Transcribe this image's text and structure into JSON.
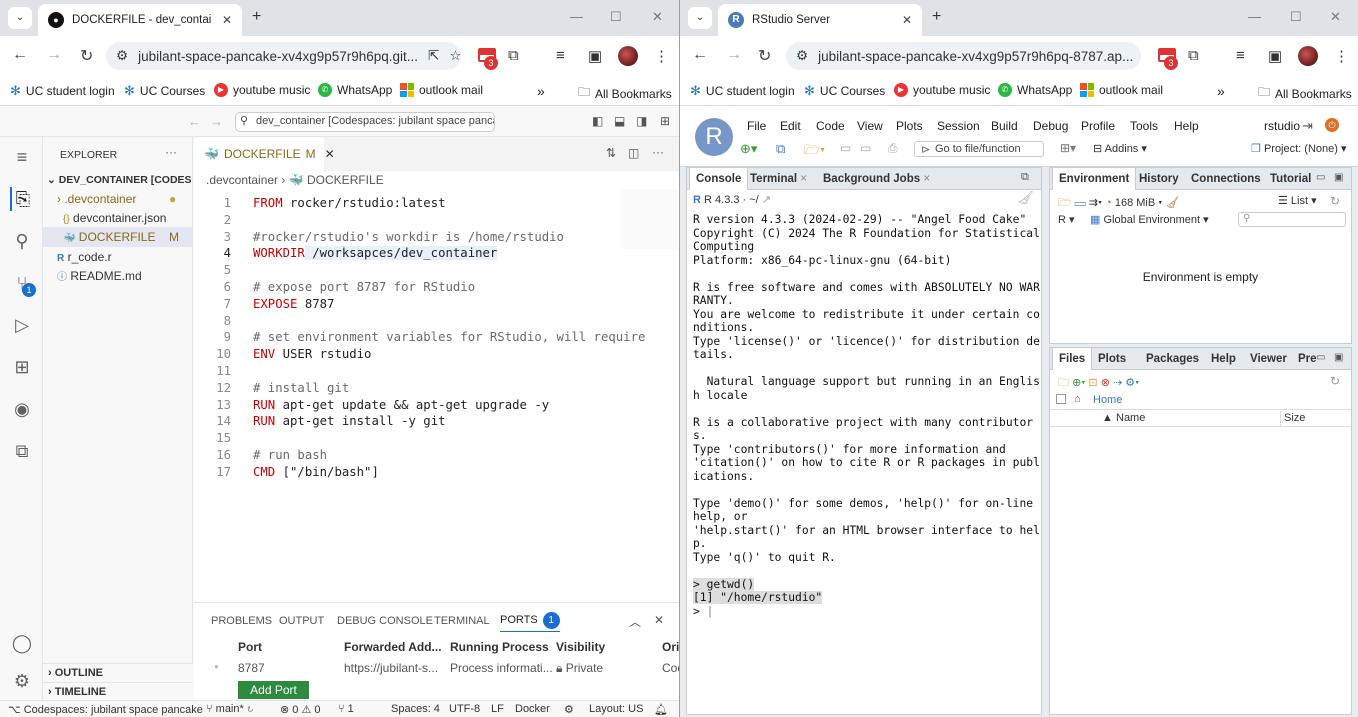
{
  "left_window": {
    "tab_title": "DOCKERFILE - dev_container [C",
    "url": "jubilant-space-pancake-xv4xg9p57r9h6pq.git...",
    "gmail_count": "3"
  },
  "right_window": {
    "tab_title": "RStudio Server",
    "url": "jubilant-space-pancake-xv4xg9p57r9h6pq-8787.ap...",
    "gmail_count": "3"
  },
  "bookmarks": {
    "items": [
      "UC student login",
      "UC Courses",
      "youtube music",
      "WhatsApp",
      "outlook mail"
    ],
    "more": "»",
    "all": "All Bookmarks"
  },
  "vscode": {
    "search": "dev_container [Codespaces: jubilant space pancake",
    "explorer_title": "EXPLORER",
    "root": "DEV_CONTAINER [CODESP...",
    "files": [
      {
        "name": ".devcontainer",
        "icon": "›"
      },
      {
        "name": "devcontainer.json",
        "icon": "{}"
      },
      {
        "name": "DOCKERFILE",
        "icon": "🐳",
        "badge": "M"
      },
      {
        "name": "r_code.r",
        "icon": "R"
      },
      {
        "name": "README.md",
        "icon": "ⓘ"
      }
    ],
    "source_control_badge": "1",
    "tab_label": "DOCKERFILE",
    "tab_badge": "M",
    "breadcrumb_folder": ".devcontainer",
    "breadcrumb_file": "DOCKERFILE",
    "code": [
      {
        "n": "1",
        "kw": "FROM",
        "rest": " rocker/rstudio:latest"
      },
      {
        "n": "2",
        "kw": "",
        "rest": ""
      },
      {
        "n": "3",
        "kw": "",
        "rest": "#rocker/rstudio's workdir is /home/rstudio",
        "comment": true
      },
      {
        "n": "4",
        "kw": "WORKDIR",
        "rest": " /worksapces/dev_container",
        "current": true
      },
      {
        "n": "5",
        "kw": "",
        "rest": ""
      },
      {
        "n": "6",
        "kw": "",
        "rest": "# expose port 8787 for RStudio",
        "comment": true
      },
      {
        "n": "7",
        "kw": "EXPOSE",
        "rest": " 8787"
      },
      {
        "n": "8",
        "kw": "",
        "rest": ""
      },
      {
        "n": "9",
        "kw": "",
        "rest": "# set environment variables for RStudio, will require",
        "comment": true
      },
      {
        "n": "10",
        "kw": "ENV",
        "rest": " USER rstudio"
      },
      {
        "n": "11",
        "kw": "",
        "rest": ""
      },
      {
        "n": "12",
        "kw": "",
        "rest": "# install git",
        "comment": true
      },
      {
        "n": "13",
        "kw": "RUN",
        "rest": " apt-get update && apt-get upgrade -y"
      },
      {
        "n": "14",
        "kw": "RUN",
        "rest": " apt-get install -y git"
      },
      {
        "n": "15",
        "kw": "",
        "rest": ""
      },
      {
        "n": "16",
        "kw": "",
        "rest": "# run bash",
        "comment": true
      },
      {
        "n": "17",
        "kw": "CMD",
        "rest": " [\"/bin/bash\"]"
      }
    ],
    "panel_tabs": [
      "PROBLEMS",
      "OUTPUT",
      "DEBUG CONSOLE",
      "TERMINAL",
      "PORTS"
    ],
    "ports_count": "1",
    "ports_headers": [
      "Port",
      "Forwarded Add...",
      "Running Process",
      "Visibility",
      "Ori"
    ],
    "ports_row": [
      "8787",
      "https://jubilant-s...",
      "Process informati...",
      "Private",
      "Coc"
    ],
    "add_port": "Add Port",
    "outline": "OUTLINE",
    "timeline": "TIMELINE",
    "status": {
      "remote": "Codespaces: jubilant space pancake",
      "branch": "main*",
      "errors": "0",
      "warnings": "0",
      "ports": "1",
      "spaces": "Spaces: 4",
      "encoding": "UTF-8",
      "eol": "LF",
      "language": "Docker",
      "layout": "Layout: US"
    }
  },
  "rstudio": {
    "menu": [
      "File",
      "Edit",
      "Code",
      "View",
      "Plots",
      "Session",
      "Build",
      "Debug",
      "Profile",
      "Tools",
      "Help"
    ],
    "user": "rstudio",
    "goto": "Go to file/function",
    "addins": "Addins",
    "project": "Project: (None)",
    "console_tabs": [
      "Console",
      "Terminal",
      "Background Jobs"
    ],
    "r_version": "R 4.3.3 · ~/",
    "console_lines": [
      "R version 4.3.3 (2024-02-29) -- \"Angel Food Cake\"",
      "Copyright (C) 2024 The R Foundation for Statistical",
      "Computing",
      "Platform: x86_64-pc-linux-gnu (64-bit)",
      "",
      "R is free software and comes with ABSOLUTELY NO WAR",
      "RANTY.",
      "You are welcome to redistribute it under certain co",
      "nditions.",
      "Type 'license()' or 'licence()' for distribution de",
      "tails.",
      "",
      "  Natural language support but running in an Englis",
      "h locale",
      "",
      "R is a collaborative project with many contributor",
      "s.",
      "Type 'contributors()' for more information and",
      "'citation()' on how to cite R or R packages in publ",
      "ications.",
      "",
      "Type 'demo()' for some demos, 'help()' for on-line",
      "help, or",
      "'help.start()' for an HTML browser interface to hel",
      "p.",
      "Type 'q()' to quit R.",
      ""
    ],
    "cmd": "> getwd()",
    "result": "[1] \"/home/rstudio\"",
    "prompt": ">",
    "env_tabs": [
      "Environment",
      "History",
      "Connections",
      "Tutorial"
    ],
    "memory": "168 MiB",
    "list": "List",
    "r_select": "R",
    "global_env": "Global Environment",
    "env_empty": "Environment is empty",
    "files_tabs": [
      "Files",
      "Plots",
      "Packages",
      "Help",
      "Viewer",
      "Pre"
    ],
    "home": "Home",
    "col_name": "Name",
    "col_size": "Size"
  }
}
